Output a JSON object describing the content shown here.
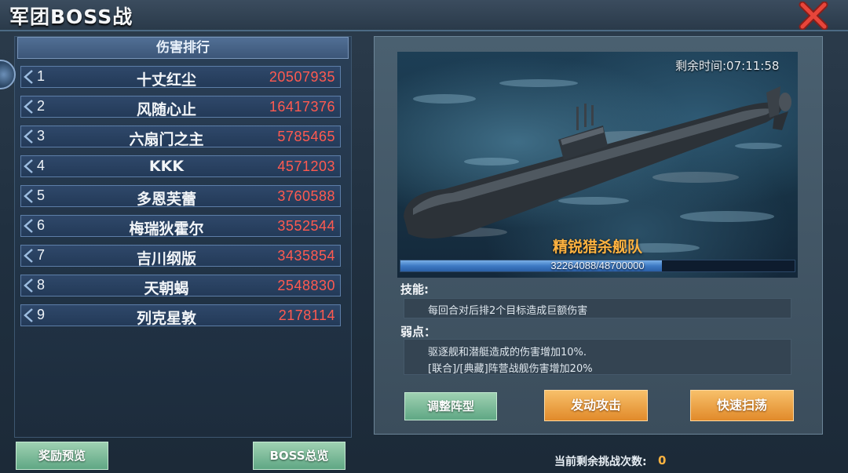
{
  "window": {
    "title": "军团BOSS战",
    "close_icon": "close-x-icon"
  },
  "ranking": {
    "header": "伤害排行",
    "rows": [
      {
        "rank": "1",
        "name": "十丈红尘",
        "damage": "20507935"
      },
      {
        "rank": "2",
        "name": "风随心止",
        "damage": "16417376"
      },
      {
        "rank": "3",
        "name": "六扇门之主",
        "damage": "5785465"
      },
      {
        "rank": "4",
        "name": "KKK",
        "damage": "4571203"
      },
      {
        "rank": "5",
        "name": "多恩芙蕾",
        "damage": "3760588"
      },
      {
        "rank": "6",
        "name": "梅瑞狄霍尔",
        "damage": "3552544"
      },
      {
        "rank": "7",
        "name": "吉川纲版",
        "damage": "3435854"
      },
      {
        "rank": "8",
        "name": "天朝蝎",
        "damage": "2548830"
      },
      {
        "rank": "9",
        "name": "列克星敦",
        "damage": "2178114"
      }
    ]
  },
  "boss": {
    "timer": "剩余时间:07:11:58",
    "name": "精锐猎杀舰队",
    "hp_text": "32264088/48700000",
    "hp_current": 32264088,
    "hp_max": 48700000,
    "skill_label": "技能:",
    "skill_text": "每回合对后排2个目标造成巨额伤害",
    "weak_label": "弱点：",
    "weak_lines": [
      "驱逐舰和潜艇造成的伤害增加10%.",
      "[联合]/[典藏]阵营战舰伤害增加20%"
    ]
  },
  "buttons": {
    "reward_preview": "奖励预览",
    "boss_overview": "BOSS总览",
    "adjust_formation": "调整阵型",
    "attack": "发动攻击",
    "quick_sweep": "快速扫荡"
  },
  "footer": {
    "attempts_label": "当前剩余挑战次数:",
    "attempts_count": "0"
  },
  "colors": {
    "damage": "#ff5a50",
    "boss_name": "#ffb340",
    "accent_green": "#5fa784",
    "accent_orange": "#e18a2a"
  }
}
